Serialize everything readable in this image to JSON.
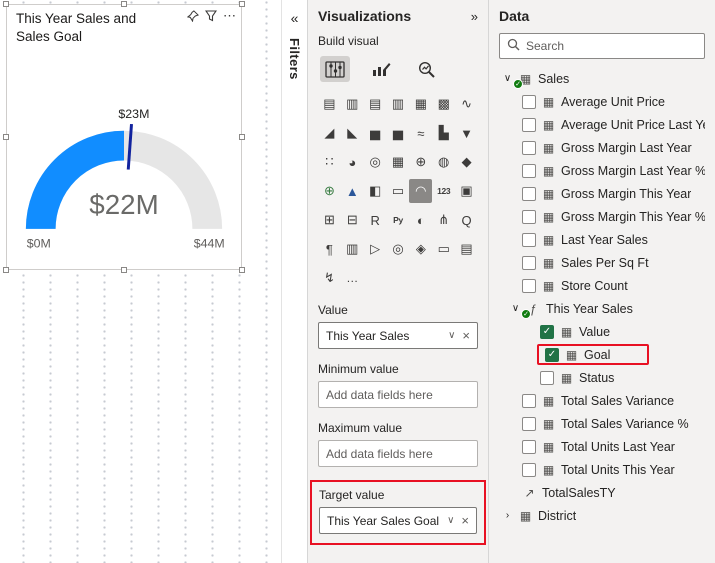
{
  "canvas": {
    "visual": {
      "title": "This Year Sales and Sales Goal",
      "gauge": {
        "type": "gauge",
        "min": 0,
        "max": 44,
        "value": 22,
        "target": 23,
        "min_label": "$0M",
        "max_label": "$44M",
        "value_label": "$22M",
        "target_label": "$23M",
        "arc_color": "#118DFF",
        "track_color": "#E6E6E6",
        "needle_color": "#12239E"
      },
      "header_icons": [
        "pin-icon",
        "filter-icon",
        "more-options-icon"
      ]
    }
  },
  "filters_pane": {
    "label": "Filters",
    "expand_icon": "«"
  },
  "visualizations_pane": {
    "title": "Visualizations",
    "collapse_icon": "»",
    "build_label": "Build visual",
    "mode_tabs": [
      "build-visual",
      "format-visual",
      "analytics"
    ],
    "icon_grid": [
      {
        "name": "stacked-bar-chart",
        "glyph": "▤"
      },
      {
        "name": "stacked-column-chart",
        "glyph": "▥"
      },
      {
        "name": "clustered-bar-chart",
        "glyph": "▤"
      },
      {
        "name": "clustered-column-chart",
        "glyph": "▥"
      },
      {
        "name": "100-stacked-bar-chart",
        "glyph": "▦"
      },
      {
        "name": "100-stacked-column-chart",
        "glyph": "▩"
      },
      {
        "name": "line-chart",
        "glyph": "∿"
      },
      {
        "name": "area-chart",
        "glyph": "◢"
      },
      {
        "name": "stacked-area-chart",
        "glyph": "◣"
      },
      {
        "name": "line-and-stacked-column-chart",
        "glyph": "▅"
      },
      {
        "name": "line-and-clustered-column-chart",
        "glyph": "▅"
      },
      {
        "name": "ribbon-chart",
        "glyph": "≈"
      },
      {
        "name": "waterfall-chart",
        "glyph": "▙"
      },
      {
        "name": "funnel-chart",
        "glyph": "▼"
      },
      {
        "name": "scatter-chart",
        "glyph": "∷"
      },
      {
        "name": "pie-chart",
        "glyph": "◕"
      },
      {
        "name": "donut-chart",
        "glyph": "◎"
      },
      {
        "name": "treemap",
        "glyph": "▦"
      },
      {
        "name": "map",
        "glyph": "⊕"
      },
      {
        "name": "filled-map",
        "glyph": "◍"
      },
      {
        "name": "shape-map",
        "glyph": "◆"
      },
      {
        "name": "arcgis-map",
        "glyph": "⊕",
        "color": "#3A7D44"
      },
      {
        "name": "azure-map",
        "glyph": "▲",
        "color": "#2B579A"
      },
      {
        "name": "kpi",
        "glyph": "◧"
      },
      {
        "name": "multi-row-card",
        "glyph": "▭"
      },
      {
        "name": "gauge",
        "glyph": "◠",
        "selected": true
      },
      {
        "name": "card",
        "glyph": "123"
      },
      {
        "name": "slicer",
        "glyph": "▣"
      },
      {
        "name": "table",
        "glyph": "⊞"
      },
      {
        "name": "matrix",
        "glyph": "⊟"
      },
      {
        "name": "r-script-visual",
        "glyph": "R"
      },
      {
        "name": "python-visual",
        "glyph": "Py"
      },
      {
        "name": "key-influencers",
        "glyph": "◐"
      },
      {
        "name": "decomposition-tree",
        "glyph": "⋔"
      },
      {
        "name": "qa-visual",
        "glyph": "Q"
      },
      {
        "name": "smart-narrative",
        "glyph": "¶"
      },
      {
        "name": "paginated-report",
        "glyph": "▥"
      },
      {
        "name": "power-apps",
        "glyph": "▷"
      },
      {
        "name": "goals",
        "glyph": "◎"
      },
      {
        "name": "custom-visual",
        "glyph": "◈"
      },
      {
        "name": "text-box",
        "glyph": "▭"
      },
      {
        "name": "scorecard",
        "glyph": "▤"
      },
      {
        "name": "power-automate",
        "glyph": "↯"
      }
    ],
    "more_label": "…",
    "wells": [
      {
        "label": "Value",
        "empty": false,
        "value": "This Year Sales"
      },
      {
        "label": "Minimum value",
        "empty": true,
        "placeholder": "Add data fields here"
      },
      {
        "label": "Maximum value",
        "empty": true,
        "placeholder": "Add data fields here"
      },
      {
        "label": "Target value",
        "empty": false,
        "value": "This Year Sales Goal",
        "highlighted": true
      }
    ]
  },
  "data_pane": {
    "title": "Data",
    "search_placeholder": "Search",
    "rows": [
      {
        "label": "Sales",
        "indent": 0,
        "expander": "down",
        "checkbox": "none",
        "icon": "table",
        "badge": true
      },
      {
        "label": "Average Unit Price",
        "indent": 20,
        "checkbox": "unchecked",
        "icon": "field"
      },
      {
        "label": "Average Unit Price Last Year",
        "indent": 20,
        "checkbox": "unchecked",
        "icon": "field"
      },
      {
        "label": "Gross Margin Last Year",
        "indent": 20,
        "checkbox": "unchecked",
        "icon": "field"
      },
      {
        "label": "Gross Margin Last Year %",
        "indent": 20,
        "checkbox": "unchecked",
        "icon": "field"
      },
      {
        "label": "Gross Margin This Year",
        "indent": 20,
        "checkbox": "unchecked",
        "icon": "field"
      },
      {
        "label": "Gross Margin This Year %",
        "indent": 20,
        "checkbox": "unchecked",
        "icon": "field"
      },
      {
        "label": "Last Year Sales",
        "indent": 20,
        "checkbox": "unchecked",
        "icon": "field"
      },
      {
        "label": "Sales Per Sq Ft",
        "indent": 20,
        "checkbox": "unchecked",
        "icon": "field"
      },
      {
        "label": "Store Count",
        "indent": 20,
        "checkbox": "unchecked",
        "icon": "field"
      },
      {
        "label": "This Year Sales",
        "indent": 8,
        "expander": "down",
        "checkbox": "none",
        "icon": "measure",
        "badge": true
      },
      {
        "label": "Value",
        "indent": 38,
        "checkbox": "checked",
        "icon": "field"
      },
      {
        "label": "Goal",
        "indent": 38,
        "checkbox": "checked",
        "icon": "field",
        "highlight": true
      },
      {
        "label": "Status",
        "indent": 38,
        "checkbox": "unchecked",
        "icon": "field"
      },
      {
        "label": "Total Sales Variance",
        "indent": 20,
        "checkbox": "unchecked",
        "icon": "field"
      },
      {
        "label": "Total Sales Variance %",
        "indent": 20,
        "checkbox": "unchecked",
        "icon": "field"
      },
      {
        "label": "Total Units Last Year",
        "indent": 20,
        "checkbox": "unchecked",
        "icon": "field"
      },
      {
        "label": "Total Units This Year",
        "indent": 20,
        "checkbox": "unchecked",
        "icon": "field"
      },
      {
        "label": "TotalSalesTY",
        "indent": 20,
        "checkbox": "none",
        "icon": "arrow"
      },
      {
        "label": "District",
        "indent": 0,
        "expander": "right",
        "checkbox": "none",
        "icon": "table"
      }
    ]
  },
  "colors": {
    "accent_blue": "#118DFF",
    "target_navy": "#12239E",
    "highlight_red": "#E81123",
    "badge_green": "#107C10",
    "checkbox_checked": "#217346",
    "track_gray": "#E6E6E6"
  }
}
